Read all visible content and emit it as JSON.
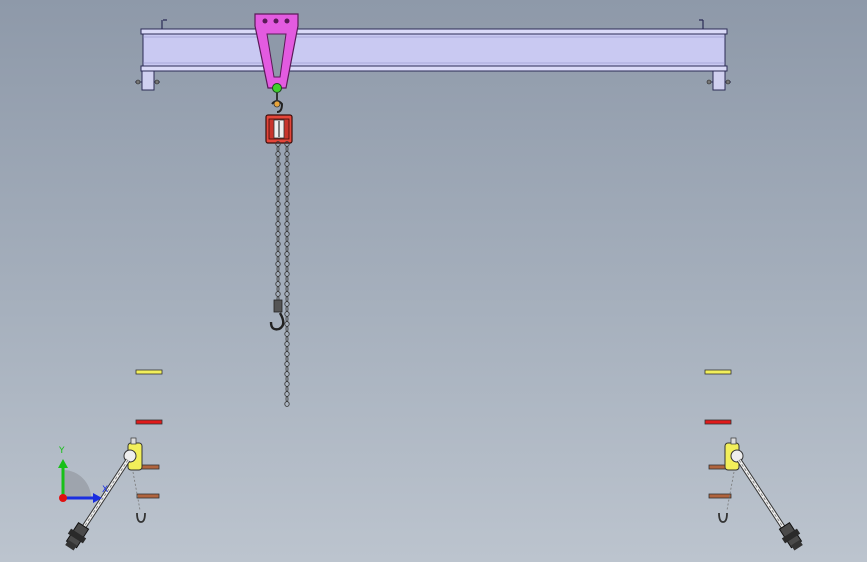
{
  "viewport": {
    "background_top": "#8e99a9",
    "background_bottom": "#bcc4ce"
  },
  "colors": {
    "beam_fill": "#c9c9f2",
    "beam_stroke": "#2b2b55",
    "trolley_plate": "#e35be0",
    "hoist_body": "#e4463a",
    "chain": "#3a3a3a",
    "clamp_yellow": "#f2ef5a",
    "clamp_red": "#e01a1a",
    "pin_brown": "#b0643e",
    "leg_fill": "#e8e8e8"
  },
  "triad": {
    "y_label": "Y",
    "x_label": "X",
    "y_color": "#18c018",
    "x_color": "#1a2ee0",
    "origin_color": "#e01010"
  },
  "parts": [
    {
      "name": "gantry-beam",
      "description_icon": "i-beam-icon"
    },
    {
      "name": "trolley-plate",
      "description_icon": "trolley-icon"
    },
    {
      "name": "chain-hoist",
      "description_icon": "hoist-icon"
    },
    {
      "name": "load-hook",
      "description_icon": "hook-icon"
    },
    {
      "name": "left-leg-assembly",
      "description_icon": "support-leg-icon"
    },
    {
      "name": "right-leg-assembly",
      "description_icon": "support-leg-icon"
    }
  ]
}
